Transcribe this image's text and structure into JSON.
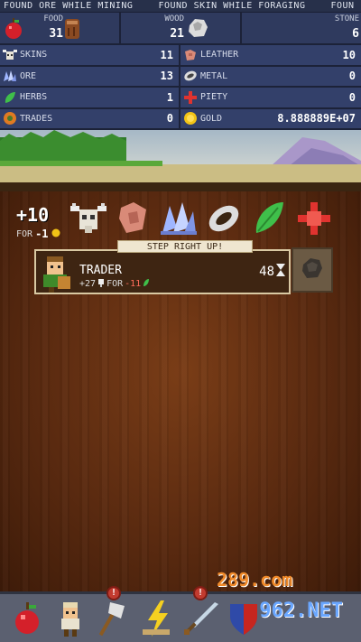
{
  "ticker": [
    "FOUND ORE WHILE MINING",
    "FOUND SKIN WHILE FORAGING",
    "FOUN"
  ],
  "resources": [
    {
      "name": "FOOD",
      "value": "31",
      "icon": "apple-icon"
    },
    {
      "name": "WOOD",
      "value": "21",
      "icon": "log-icon"
    },
    {
      "name": "STONE",
      "value": "6",
      "icon": "stone-icon"
    }
  ],
  "stats": [
    {
      "label": "SKINS",
      "value": "11",
      "icon": "skull-icon"
    },
    {
      "label": "LEATHER",
      "value": "10",
      "icon": "leather-icon"
    },
    {
      "label": "ORE",
      "value": "13",
      "icon": "ore-icon"
    },
    {
      "label": "METAL",
      "value": "0",
      "icon": "metal-icon"
    },
    {
      "label": "HERBS",
      "value": "1",
      "icon": "herb-icon"
    },
    {
      "label": "PIETY",
      "value": "0",
      "icon": "piety-icon"
    },
    {
      "label": "TRADES",
      "value": "0",
      "icon": "trades-icon"
    },
    {
      "label": "GOLD",
      "value": "8.888889E+07",
      "icon": "gold-coin-icon"
    }
  ],
  "trade": {
    "bonus": "+10",
    "for_label": "FOR",
    "for_value": "-1",
    "offers": [
      "skull-icon",
      "leather-icon",
      "ore-icon",
      "metal-icon",
      "herb-icon",
      "piety-icon"
    ],
    "sign_title": "STEP RIGHT UP!",
    "trader_name": "TRADER",
    "trader_gain": "+27",
    "trader_for": "FOR",
    "trader_cost": "-11",
    "count": "48"
  },
  "toolbar": {
    "items": [
      "apple-icon",
      "villager-icon",
      "axe-icon",
      "lightning-icon",
      "sword-icon",
      "shield-icon"
    ]
  },
  "watermark": {
    "text_top": "289.com",
    "text_bottom": "962.NET"
  }
}
